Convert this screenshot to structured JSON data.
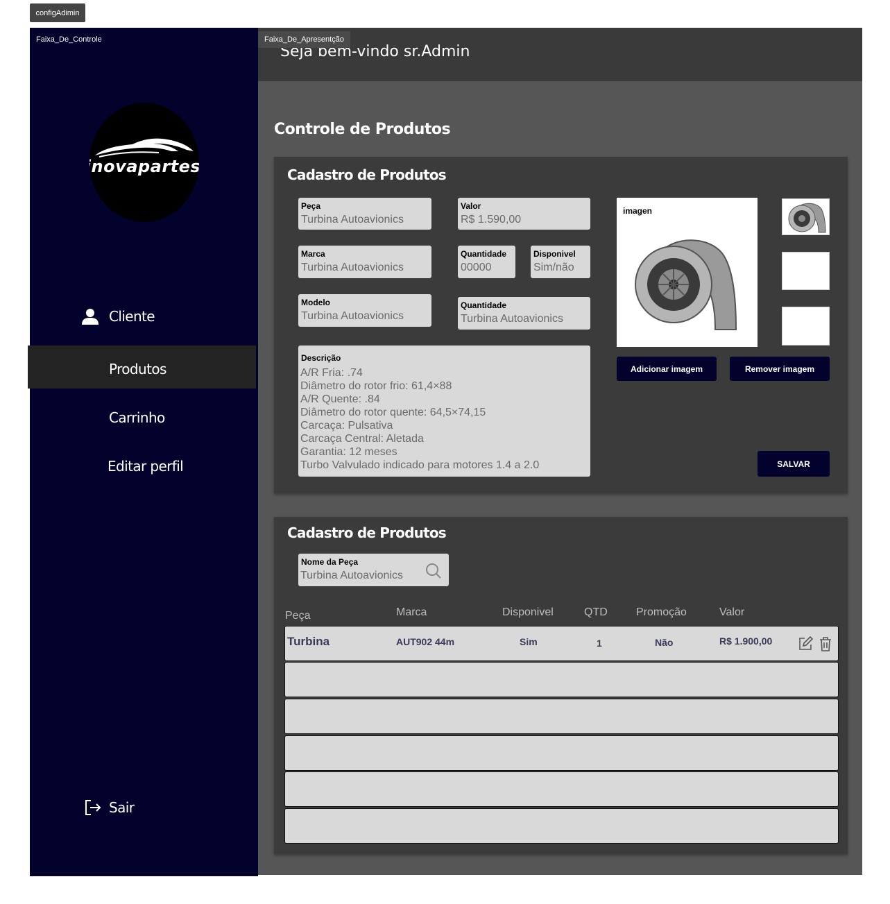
{
  "frames": {
    "config": "configAdimin",
    "sidebar": "Faixa_De_Controle",
    "main": "Faixa_De_Apresentção"
  },
  "logo": {
    "text": "inovapartes"
  },
  "nav": {
    "cliente": "Cliente",
    "produtos": "Produtos",
    "carrinho": "Carrinho",
    "editar": "Editar perfil",
    "sair": "Sair"
  },
  "header": {
    "welcome": "Seja bem-vindo sr.Admin"
  },
  "page": {
    "title": "Controle de Produtos"
  },
  "form": {
    "title": "Cadastro de Produtos",
    "peca": {
      "label": "Peça",
      "value": "Turbina Autoavionics"
    },
    "valor": {
      "label": "Valor",
      "value": "R$ 1.590,00"
    },
    "marca": {
      "label": "Marca",
      "value": "Turbina Autoavionics"
    },
    "quantidade": {
      "label": "Quantidade",
      "value": "00000"
    },
    "disponivel": {
      "label": "Disponivel",
      "value": "Sim/não"
    },
    "modelo": {
      "label": "Modelo",
      "value": "Turbina Autoavionics"
    },
    "quantidade2": {
      "label": "Quantidade",
      "value": "Turbina Autoavionics"
    },
    "descricao": {
      "label": "Descrição",
      "lines": [
        "A/R Fria: .74",
        "Diâmetro do rotor frio: 61,4×88",
        "A/R Quente: .84",
        "Diâmetro do rotor quente: 64,5×74,15",
        "Carcaça: Pulsativa",
        "Carcaça Central: Aletada",
        "Garantia: 12 meses",
        "Turbo Valvulado indicado para motores 1.4 a 2.0"
      ]
    },
    "image_label": "imagen",
    "add_image": "Adicionar imagem",
    "remove_image": "Remover imagem",
    "save": "SALVAR"
  },
  "list": {
    "title": "Cadastro de Produtos",
    "search": {
      "label": "Nome da Peça",
      "value": "Turbina Autoavionics"
    },
    "columns": [
      "Peça",
      "Marca",
      "Disponivel",
      "QTD",
      "Promoção",
      "Valor"
    ],
    "rows": [
      {
        "peca": "Turbina",
        "marca": "AUT902 44m",
        "disponivel": "Sim",
        "qtd": "1",
        "promocao": "Não",
        "valor": "R$ 1.900,00"
      }
    ],
    "empty_rows": 5
  },
  "colors": {
    "sidebar": "#02022c",
    "active_nav": "#232323",
    "main_bg": "#565656",
    "panel_bg": "#3b3b3b",
    "field_bg": "#d9d9d9"
  }
}
